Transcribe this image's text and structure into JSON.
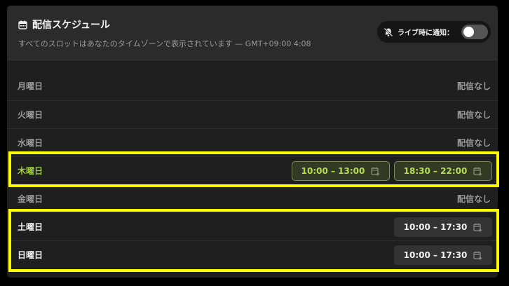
{
  "header": {
    "title": "配信スケジュール",
    "subtitle": "すべてのスロットはあなたのタイムゾーンで表示されています — GMT+09:00 4:08",
    "notify_label": "ライブ時に通知：",
    "notify_enabled": false
  },
  "schedule": {
    "no_stream_label": "配信なし",
    "days": [
      {
        "name": "月曜日",
        "slots": []
      },
      {
        "name": "火曜日",
        "slots": []
      },
      {
        "name": "水曜日",
        "slots": []
      },
      {
        "name": "木曜日",
        "slots": [
          "10:00 – 13:00",
          "18:30 – 22:00"
        ],
        "today": true
      },
      {
        "name": "金曜日",
        "slots": []
      },
      {
        "name": "土曜日",
        "slots": [
          "10:00 – 17:30"
        ]
      },
      {
        "name": "日曜日",
        "slots": [
          "10:00 – 17:30"
        ]
      }
    ]
  },
  "colors": {
    "highlight": "#ffff00",
    "today_accent": "#9ccc3d",
    "panel_bg": "#1f1f1f"
  },
  "icons": [
    "calendar-icon",
    "bell-off-icon",
    "calendar-add-icon"
  ]
}
